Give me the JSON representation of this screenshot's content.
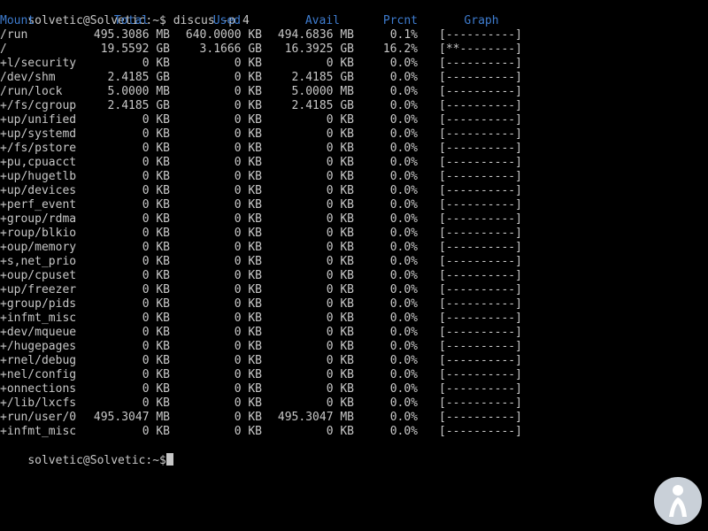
{
  "prompt_user": "solvetic@Solvetic:~$",
  "command": "discus -p 4",
  "headers": {
    "mount": "Mount",
    "total": "Total",
    "used": "Used",
    "avail": "Avail",
    "prcnt": "Prcnt",
    "graph": "Graph"
  },
  "rows": [
    {
      "mount": "/run",
      "total": "495.3086 MB",
      "used": "640.0000 KB",
      "avail": "494.6836 MB",
      "prcnt": "0.1%",
      "graph": "[----------]"
    },
    {
      "mount": "/",
      "total": "19.5592 GB",
      "used": "3.1666 GB",
      "avail": "16.3925 GB",
      "prcnt": "16.2%",
      "graph": "[**--------]"
    },
    {
      "mount": "+l/security",
      "total": "0 KB",
      "used": "0 KB",
      "avail": "0 KB",
      "prcnt": "0.0%",
      "graph": "[----------]"
    },
    {
      "mount": "/dev/shm",
      "total": "2.4185 GB",
      "used": "0 KB",
      "avail": "2.4185 GB",
      "prcnt": "0.0%",
      "graph": "[----------]"
    },
    {
      "mount": "/run/lock",
      "total": "5.0000 MB",
      "used": "0 KB",
      "avail": "5.0000 MB",
      "prcnt": "0.0%",
      "graph": "[----------]"
    },
    {
      "mount": "+/fs/cgroup",
      "total": "2.4185 GB",
      "used": "0 KB",
      "avail": "2.4185 GB",
      "prcnt": "0.0%",
      "graph": "[----------]"
    },
    {
      "mount": "+up/unified",
      "total": "0 KB",
      "used": "0 KB",
      "avail": "0 KB",
      "prcnt": "0.0%",
      "graph": "[----------]"
    },
    {
      "mount": "+up/systemd",
      "total": "0 KB",
      "used": "0 KB",
      "avail": "0 KB",
      "prcnt": "0.0%",
      "graph": "[----------]"
    },
    {
      "mount": "+/fs/pstore",
      "total": "0 KB",
      "used": "0 KB",
      "avail": "0 KB",
      "prcnt": "0.0%",
      "graph": "[----------]"
    },
    {
      "mount": "+pu,cpuacct",
      "total": "0 KB",
      "used": "0 KB",
      "avail": "0 KB",
      "prcnt": "0.0%",
      "graph": "[----------]"
    },
    {
      "mount": "+up/hugetlb",
      "total": "0 KB",
      "used": "0 KB",
      "avail": "0 KB",
      "prcnt": "0.0%",
      "graph": "[----------]"
    },
    {
      "mount": "+up/devices",
      "total": "0 KB",
      "used": "0 KB",
      "avail": "0 KB",
      "prcnt": "0.0%",
      "graph": "[----------]"
    },
    {
      "mount": "+perf_event",
      "total": "0 KB",
      "used": "0 KB",
      "avail": "0 KB",
      "prcnt": "0.0%",
      "graph": "[----------]"
    },
    {
      "mount": "+group/rdma",
      "total": "0 KB",
      "used": "0 KB",
      "avail": "0 KB",
      "prcnt": "0.0%",
      "graph": "[----------]"
    },
    {
      "mount": "+roup/blkio",
      "total": "0 KB",
      "used": "0 KB",
      "avail": "0 KB",
      "prcnt": "0.0%",
      "graph": "[----------]"
    },
    {
      "mount": "+oup/memory",
      "total": "0 KB",
      "used": "0 KB",
      "avail": "0 KB",
      "prcnt": "0.0%",
      "graph": "[----------]"
    },
    {
      "mount": "+s,net_prio",
      "total": "0 KB",
      "used": "0 KB",
      "avail": "0 KB",
      "prcnt": "0.0%",
      "graph": "[----------]"
    },
    {
      "mount": "+oup/cpuset",
      "total": "0 KB",
      "used": "0 KB",
      "avail": "0 KB",
      "prcnt": "0.0%",
      "graph": "[----------]"
    },
    {
      "mount": "+up/freezer",
      "total": "0 KB",
      "used": "0 KB",
      "avail": "0 KB",
      "prcnt": "0.0%",
      "graph": "[----------]"
    },
    {
      "mount": "+group/pids",
      "total": "0 KB",
      "used": "0 KB",
      "avail": "0 KB",
      "prcnt": "0.0%",
      "graph": "[----------]"
    },
    {
      "mount": "+infmt_misc",
      "total": "0 KB",
      "used": "0 KB",
      "avail": "0 KB",
      "prcnt": "0.0%",
      "graph": "[----------]"
    },
    {
      "mount": "+dev/mqueue",
      "total": "0 KB",
      "used": "0 KB",
      "avail": "0 KB",
      "prcnt": "0.0%",
      "graph": "[----------]"
    },
    {
      "mount": "+/hugepages",
      "total": "0 KB",
      "used": "0 KB",
      "avail": "0 KB",
      "prcnt": "0.0%",
      "graph": "[----------]"
    },
    {
      "mount": "+rnel/debug",
      "total": "0 KB",
      "used": "0 KB",
      "avail": "0 KB",
      "prcnt": "0.0%",
      "graph": "[----------]"
    },
    {
      "mount": "+nel/config",
      "total": "0 KB",
      "used": "0 KB",
      "avail": "0 KB",
      "prcnt": "0.0%",
      "graph": "[----------]"
    },
    {
      "mount": "+onnections",
      "total": "0 KB",
      "used": "0 KB",
      "avail": "0 KB",
      "prcnt": "0.0%",
      "graph": "[----------]"
    },
    {
      "mount": "+/lib/lxcfs",
      "total": "0 KB",
      "used": "0 KB",
      "avail": "0 KB",
      "prcnt": "0.0%",
      "graph": "[----------]"
    },
    {
      "mount": "+run/user/0",
      "total": "495.3047 MB",
      "used": "0 KB",
      "avail": "495.3047 MB",
      "prcnt": "0.0%",
      "graph": "[----------]"
    },
    {
      "mount": "+infmt_misc",
      "total": "0 KB",
      "used": "0 KB",
      "avail": "0 KB",
      "prcnt": "0.0%",
      "graph": "[----------]"
    }
  ],
  "colors": {
    "background": "#000000",
    "text": "#c7c7c7",
    "header": "#3e7ccf",
    "watermark_circle": "#c9d0d8",
    "watermark_figure": "#ffffff"
  },
  "icons": {
    "watermark": "solvetic-logo-icon"
  }
}
